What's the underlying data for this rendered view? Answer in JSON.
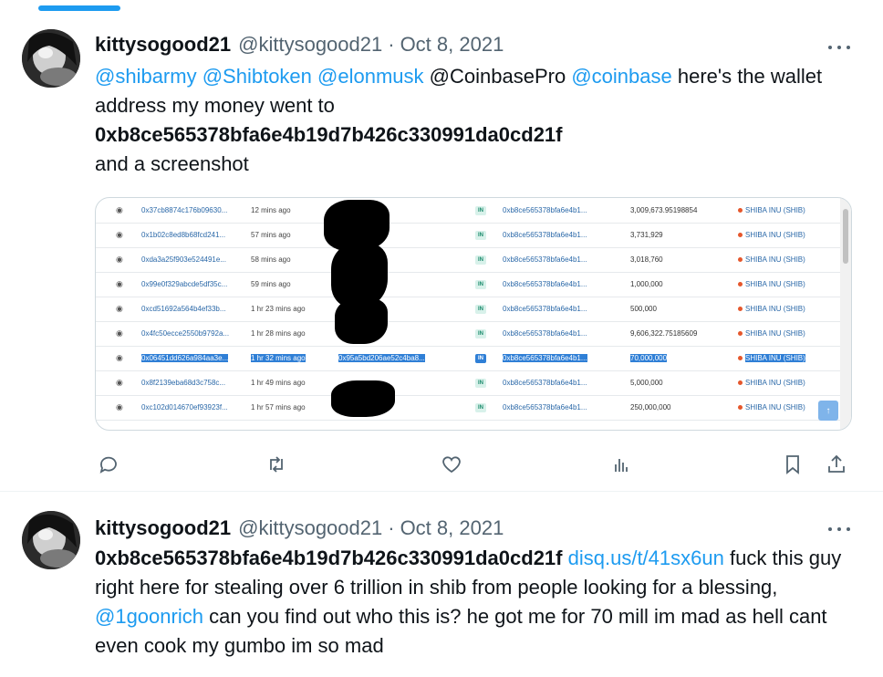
{
  "tweets": [
    {
      "author": {
        "name": "kittysogood21",
        "handle": "@kittysogood21",
        "date": "Oct 8, 2021"
      },
      "text": {
        "mention1": "@shibarmy",
        "mention2": "@Shibtoken",
        "mention3": "@elonmusk",
        "plain1": "@CoinbasePro",
        "mention4": "@coinbase",
        "plain2": "here's the wallet address my money went to",
        "address": "0xb8ce565378bfa6e4b19d7b426c330991da0cd21f",
        "plain3": "and  a screenshot"
      },
      "media": {
        "rows": [
          {
            "hash": "0x37cb8874c176b09630...",
            "age": "12 mins ago",
            "dir": "IN",
            "to": "0xb8ce565378bfa6e4b1...",
            "amount": "3,009,673.95198854",
            "token": "SHIBA INU (SHIB)",
            "from": ""
          },
          {
            "hash": "0x1b02c8ed8b68fcd241...",
            "age": "57 mins ago",
            "dir": "IN",
            "to": "0xb8ce565378bfa6e4b1...",
            "amount": "3,731,929",
            "token": "SHIBA INU (SHIB)",
            "from": ""
          },
          {
            "hash": "0xda3a25f903e524491e...",
            "age": "58 mins ago",
            "dir": "IN",
            "to": "0xb8ce565378bfa6e4b1...",
            "amount": "3,018,760",
            "token": "SHIBA INU (SHIB)",
            "from": ""
          },
          {
            "hash": "0x99e0f329abcde5df35c...",
            "age": "59 mins ago",
            "dir": "IN",
            "to": "0xb8ce565378bfa6e4b1...",
            "amount": "1,000,000",
            "token": "SHIBA INU (SHIB)",
            "from": ""
          },
          {
            "hash": "0xcd51692a564b4ef33b...",
            "age": "1 hr 23 mins ago",
            "dir": "IN",
            "to": "0xb8ce565378bfa6e4b1...",
            "amount": "500,000",
            "token": "SHIBA INU (SHIB)",
            "from": ""
          },
          {
            "hash": "0x4fc50ecce2550b9792a...",
            "age": "1 hr 28 mins ago",
            "dir": "IN",
            "to": "0xb8ce565378bfa6e4b1...",
            "amount": "9,606,322.75185609",
            "token": "SHIBA INU (SHIB)",
            "from": ""
          },
          {
            "hash": "0x06451dd626a984aa3e...",
            "age": "1 hr 32 mins ago",
            "dir": "IN",
            "to": "0xb8ce565378bfa6e4b1...",
            "amount": "70,000,000",
            "token": "SHIBA INU (SHIB)",
            "from": "0x95a5bd206ae52c4ba8..."
          },
          {
            "hash": "0x8f2139eba68d3c758c...",
            "age": "1 hr 49 mins ago",
            "dir": "IN",
            "to": "0xb8ce565378bfa6e4b1...",
            "amount": "5,000,000",
            "token": "SHIBA INU (SHIB)",
            "from": ""
          },
          {
            "hash": "0xc102d014670ef93923f...",
            "age": "1 hr 57 mins ago",
            "dir": "IN",
            "to": "0xb8ce565378bfa6e4b1...",
            "amount": "250,000,000",
            "token": "SHIBA INU (SHIB)",
            "from": ""
          }
        ],
        "scroll_up_glyph": "↑"
      },
      "actions": [
        "reply-icon",
        "retweet-icon",
        "like-icon",
        "views-icon",
        "bookmark-icon",
        "share-icon"
      ]
    },
    {
      "author": {
        "name": "kittysogood21",
        "handle": "@kittysogood21",
        "date": "Oct 8, 2021"
      },
      "text": {
        "address": "0xb8ce565378bfa6e4b19d7b426c330991da0cd21f",
        "link": "disq.us/t/41sx6un",
        "plain1": "fuck this guy right here for stealing over 6 trillion in shib from people looking for a blessing,",
        "mention": "@1goonrich",
        "plain2": "can you find out who this is? he got me for 70 mill im mad as hell cant even cook my gumbo im so mad"
      }
    }
  ],
  "separators": {
    "dot": "·"
  },
  "colors": {
    "accent": "#1d9bf0",
    "secondary": "#536471",
    "text": "#0f1419"
  }
}
